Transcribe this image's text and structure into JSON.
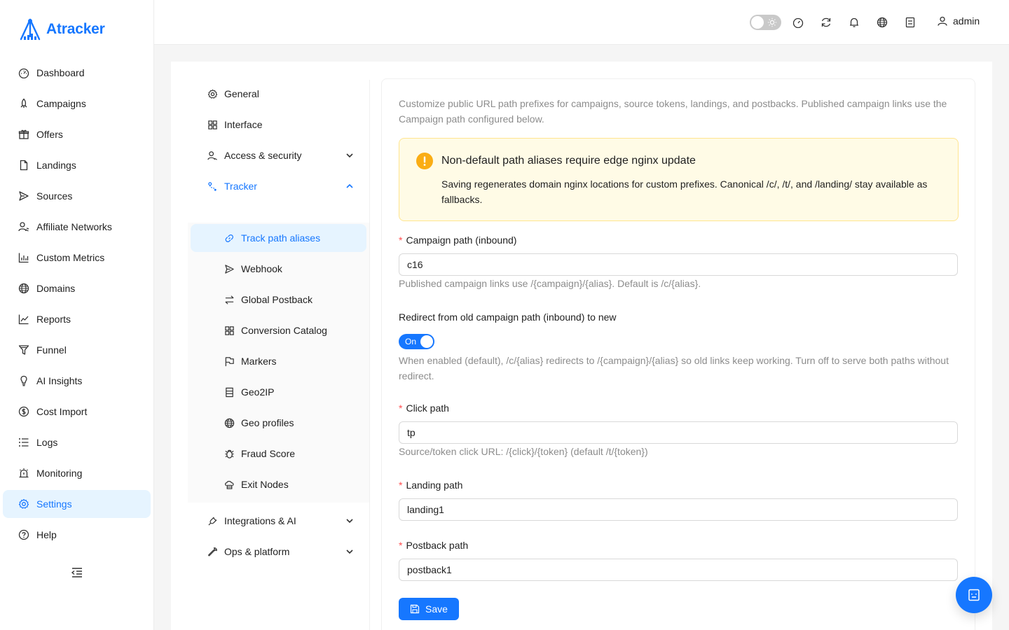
{
  "app": {
    "name": "Atracker",
    "brand_color": "#1677ff"
  },
  "header": {
    "user": "admin",
    "icons": [
      "theme-toggle",
      "dashboard-icon",
      "refresh-icon",
      "bell-icon",
      "globe-icon",
      "notebook-icon",
      "user-icon"
    ]
  },
  "sidebar": {
    "items": [
      {
        "label": "Dashboard",
        "icon": "dashboard-icon"
      },
      {
        "label": "Campaigns",
        "icon": "rocket-icon"
      },
      {
        "label": "Offers",
        "icon": "gift-icon"
      },
      {
        "label": "Landings",
        "icon": "file-icon"
      },
      {
        "label": "Sources",
        "icon": "send-icon"
      },
      {
        "label": "Affiliate Networks",
        "icon": "users-icon"
      },
      {
        "label": "Custom Metrics",
        "icon": "bar-chart-icon"
      },
      {
        "label": "Domains",
        "icon": "globe-icon"
      },
      {
        "label": "Reports",
        "icon": "line-chart-icon"
      },
      {
        "label": "Funnel",
        "icon": "funnel-icon"
      },
      {
        "label": "AI Insights",
        "icon": "bulb-icon"
      },
      {
        "label": "Cost Import",
        "icon": "dollar-icon"
      },
      {
        "label": "Logs",
        "icon": "list-icon"
      },
      {
        "label": "Monitoring",
        "icon": "alarm-icon"
      },
      {
        "label": "Settings",
        "icon": "gear-icon"
      },
      {
        "label": "Help",
        "icon": "question-icon"
      }
    ],
    "active": "Settings"
  },
  "settings_menu": {
    "items": [
      "General",
      "Interface",
      "Access & security",
      "Tracker",
      "Integrations & AI",
      "Ops & platform"
    ],
    "tracker_children": [
      "Track path aliases",
      "Webhook",
      "Global Postback",
      "Conversion Catalog",
      "Markers",
      "Geo2IP",
      "Geo profiles",
      "Fraud Score",
      "Exit Nodes"
    ],
    "active": "Track path aliases"
  },
  "form": {
    "intro": "Customize public URL path prefixes for campaigns, source tokens, landings, and postbacks. Published campaign links use the Campaign path configured below.",
    "alert": {
      "title": "Non-default path aliases require edge nginx update",
      "description": "Saving regenerates domain nginx locations for custom prefixes. Canonical /c/, /t/, and /landing/ stay available as fallbacks."
    },
    "campaign_path": {
      "label": "Campaign path (inbound)",
      "value": "c16",
      "help": "Published campaign links use /{campaign}/{alias}. Default is /c/{alias}."
    },
    "redirect": {
      "label": "Redirect from old campaign path (inbound) to new",
      "state": "On",
      "help": "When enabled (default), /c/{alias} redirects to /{campaign}/{alias} so old links keep working. Turn off to serve both paths without redirect."
    },
    "click_path": {
      "label": "Click path",
      "value": "tp",
      "help": "Source/token click URL: /{click}/{token} (default /t/{token})"
    },
    "landing_path": {
      "label": "Landing path",
      "value": "landing1"
    },
    "postback_path": {
      "label": "Postback path",
      "value": "postback1"
    },
    "required_mark": "*",
    "save_label": "Save"
  }
}
